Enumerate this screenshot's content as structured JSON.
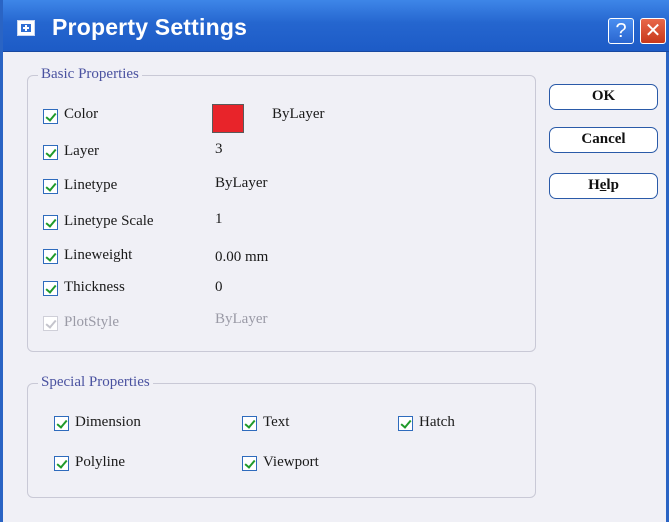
{
  "window": {
    "title": "Property Settings"
  },
  "titlebar_buttons": {
    "help": "?",
    "close": "✕"
  },
  "basic": {
    "title": "Basic Properties",
    "color_label": "Color",
    "color_value": "ByLayer",
    "color_swatch": "#e8242a",
    "layer_label": "Layer",
    "layer_value": "3",
    "linetype_label": "Linetype",
    "linetype_value": "ByLayer",
    "linetype_scale_label": "Linetype Scale",
    "linetype_scale_value": "1",
    "lineweight_label": "Lineweight",
    "lineweight_value": "0.00 mm",
    "thickness_label": "Thickness",
    "thickness_value": "0",
    "plotstyle_label": "PlotStyle",
    "plotstyle_value": "ByLayer"
  },
  "special": {
    "title": "Special Properties",
    "dimension": "Dimension",
    "text": "Text",
    "hatch": "Hatch",
    "polyline": "Polyline",
    "viewport": "Viewport"
  },
  "buttons": {
    "ok": "OK",
    "cancel": "Cancel",
    "help_pre": "H",
    "help_mnemonic": "e",
    "help_post": "lp"
  },
  "colors": {
    "titlebar": "#2566cf",
    "group_title": "#4a52a0",
    "check": "#1f9a2a"
  }
}
